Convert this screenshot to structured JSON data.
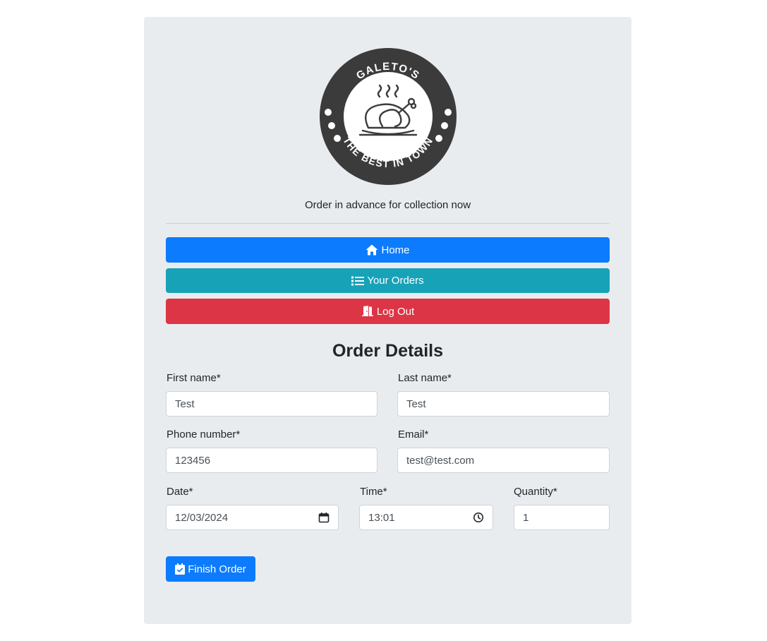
{
  "logo": {
    "top_text": "GALETO'S",
    "bottom_text": "THE BEST IN TOWN"
  },
  "tagline": "Order in advance for collection now",
  "nav": {
    "home_label": "Home",
    "orders_label": "Your Orders",
    "logout_label": "Log Out"
  },
  "form": {
    "title": "Order Details",
    "first_name": {
      "label": "First name*",
      "value": "Test"
    },
    "last_name": {
      "label": "Last name*",
      "value": "Test"
    },
    "phone": {
      "label": "Phone number*",
      "value": "123456"
    },
    "email": {
      "label": "Email*",
      "value": "test@test.com"
    },
    "date": {
      "label": "Date*",
      "value": "12/03/2024"
    },
    "time": {
      "label": "Time*",
      "value": "13:01"
    },
    "quantity": {
      "label": "Quantity*",
      "value": "1"
    },
    "submit_label": "Finish Order"
  },
  "colors": {
    "primary": "#0d7bfe",
    "info": "#17a2b8",
    "danger": "#dc3545",
    "panel": "#e9ecef"
  },
  "icons": {
    "home": "home-icon",
    "orders": "list-icon",
    "logout": "door-open-icon",
    "date": "calendar-icon",
    "time": "clock-icon",
    "submit": "calendar-check-icon"
  }
}
